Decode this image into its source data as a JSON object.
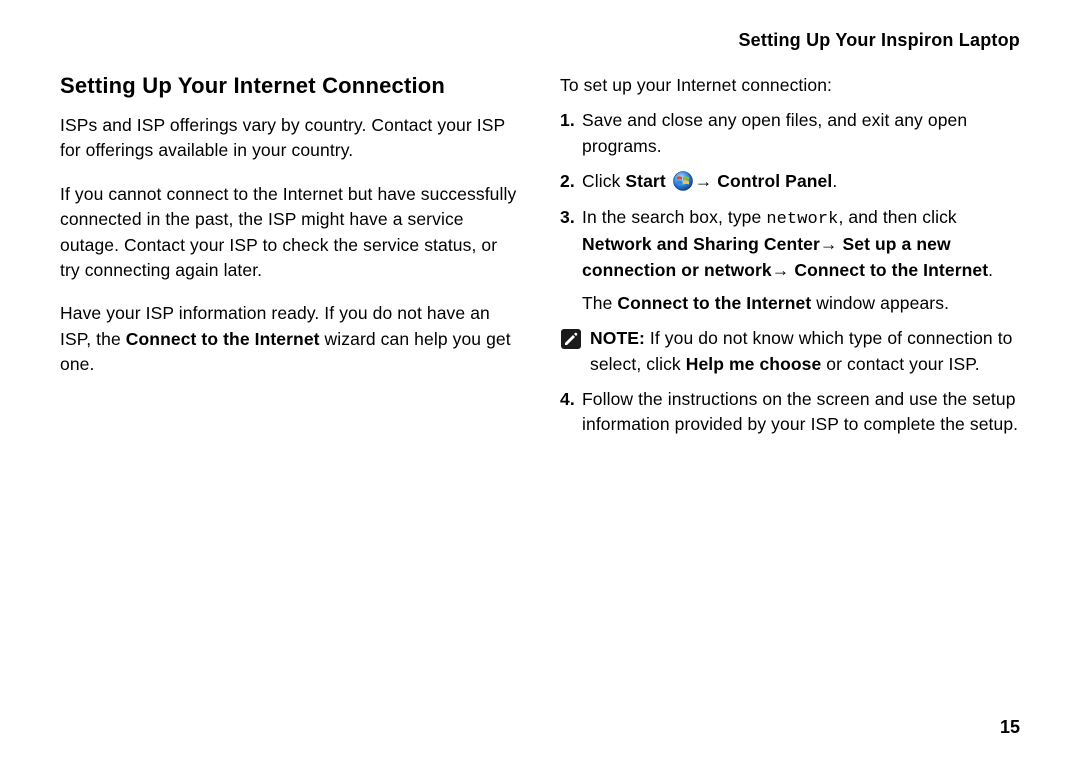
{
  "header": {
    "title": "Setting Up Your Inspiron Laptop"
  },
  "left": {
    "heading": "Setting Up Your Internet Connection",
    "p1": "ISPs and ISP offerings vary by country. Contact your ISP for offerings available in your country.",
    "p2": "If you cannot connect to the Internet but have successfully connected in the past, the ISP might have a service outage. Contact your ISP to check the service status, or try connecting again later.",
    "p3_pre": "Have your ISP information ready. If you do not have an ISP, the ",
    "p3_bold": "Connect to the Internet",
    "p3_post": " wizard can help you get one."
  },
  "right": {
    "lead": "To set up your Internet connection:",
    "steps": {
      "s1": "Save and close any open files, and exit any open programs.",
      "s2": {
        "pre": "Click ",
        "start": "Start",
        "arrow": "→ ",
        "cp": "Control Panel",
        "post": "."
      },
      "s3": {
        "pre": "In the search box, type ",
        "code": "network",
        "mid": ", and then click ",
        "b1": "Network and Sharing Center",
        "arrow1": "→ ",
        "b2": "Set up a new connection or network",
        "arrow2": "→ ",
        "b3": "Connect to the Internet",
        "post": "."
      },
      "s3_follow": {
        "pre": "The ",
        "bold": "Connect to the Internet",
        "post": " window appears."
      },
      "note": {
        "label": "NOTE:",
        "pre": " If you do not know which type of connection to select, click ",
        "bold": "Help me choose",
        "post": " or contact your ISP."
      },
      "s4": "Follow the instructions on the screen and use the setup information provided by your ISP to complete the setup."
    }
  },
  "page_number": "15"
}
